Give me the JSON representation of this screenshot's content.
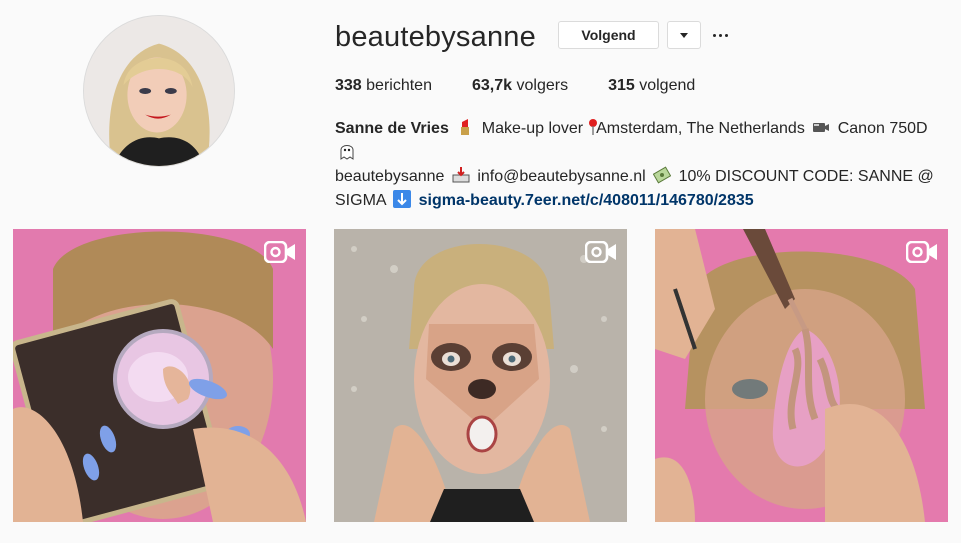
{
  "profile": {
    "username": "beautebysanne",
    "follow_label": "Volgend",
    "stats": {
      "posts_count": "338",
      "posts_label": "berichten",
      "followers_count": "63,7k",
      "followers_label": "volgers",
      "following_count": "315",
      "following_label": "volgend"
    },
    "bio": {
      "name": "Sanne de Vries",
      "part1": "Make-up lover",
      "part2": "Amsterdam, The Netherlands",
      "part3": "Canon 750D",
      "part4": "beautebysanne",
      "part5": "info@beautebysanne.nl",
      "part6": "10% DISCOUNT CODE: SANNE @ SIGMA",
      "link": "sigma-beauty.7eer.net/c/408011/146780/2835"
    },
    "bio_icons": [
      "lipstick-icon",
      "round-pushpin-icon",
      "video-camera-icon",
      "ghost-icon",
      "inbox-tray-icon",
      "money-icon",
      "down-arrow-icon"
    ]
  },
  "posts": [
    {
      "type": "video",
      "icon": "video-camera-icon"
    },
    {
      "type": "video",
      "icon": "video-camera-icon"
    },
    {
      "type": "video",
      "icon": "video-camera-icon"
    }
  ],
  "colors": {
    "link": "#003569",
    "background": "#fafafa",
    "border": "#dbdbdb",
    "pink_backdrop": "#e47aad"
  }
}
